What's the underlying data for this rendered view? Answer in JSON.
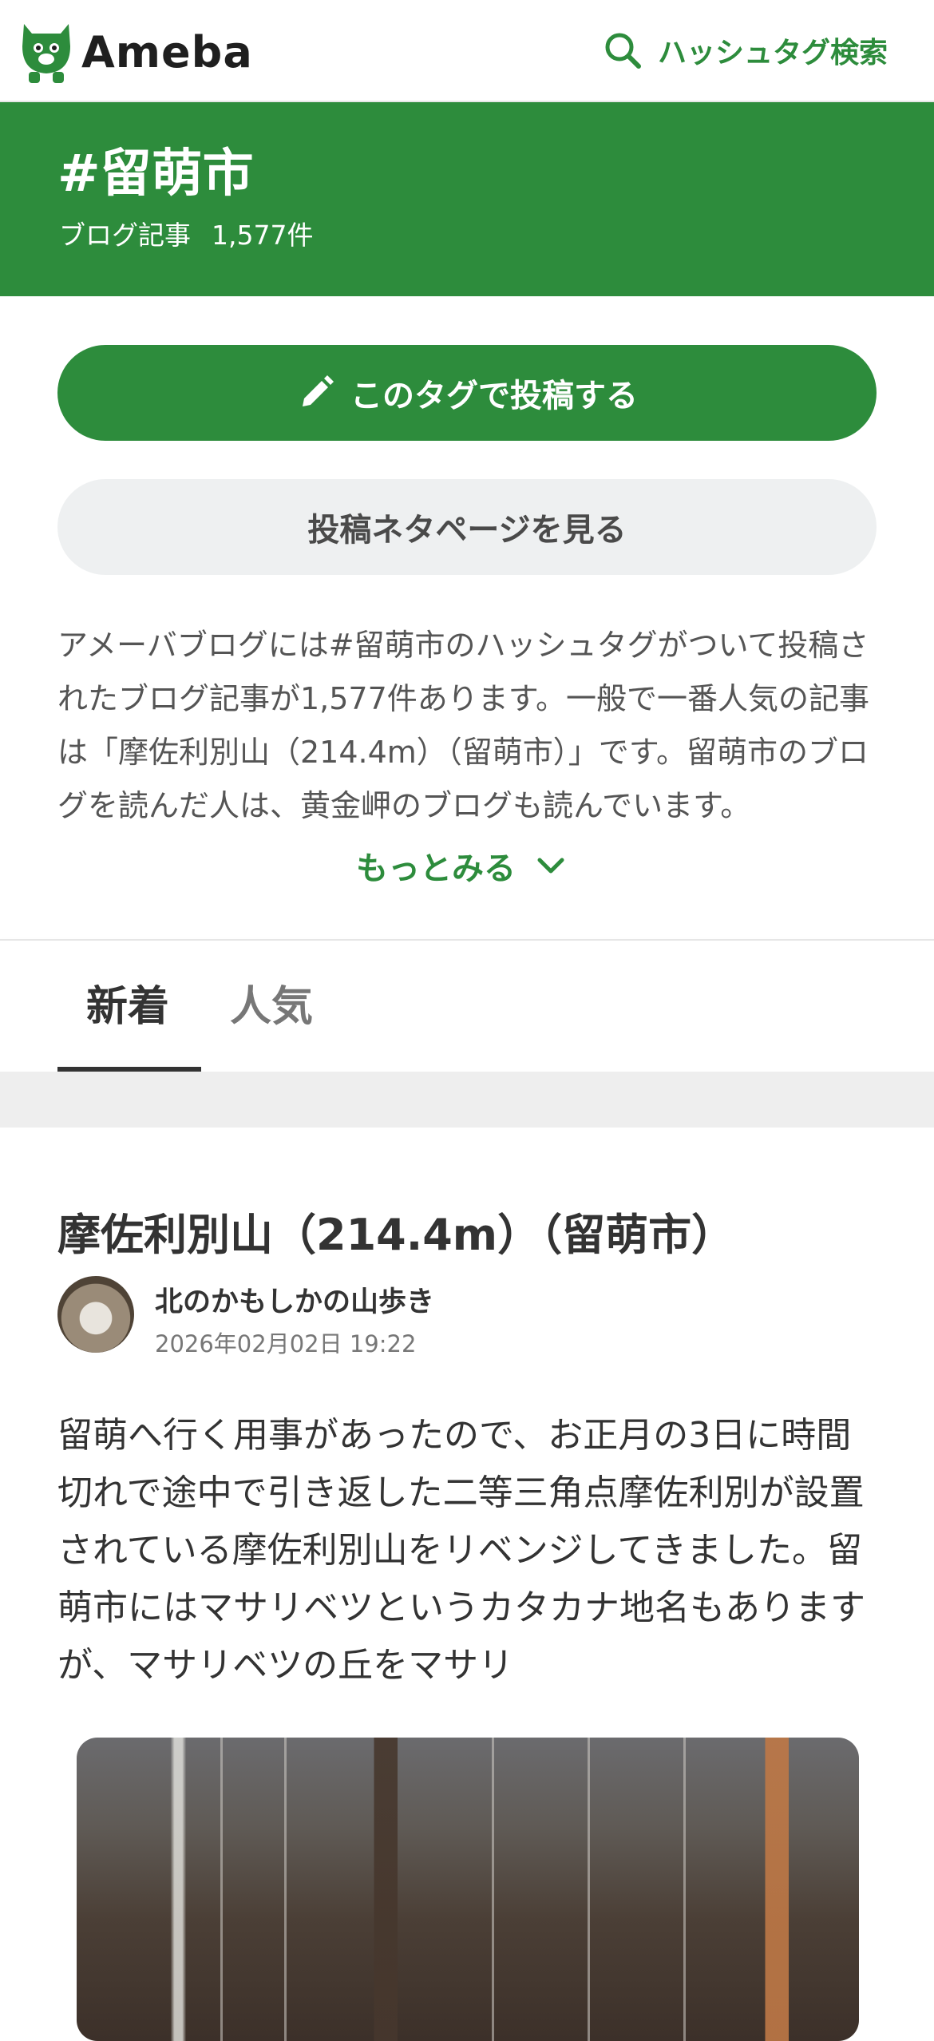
{
  "header": {
    "logo_text": "Ameba",
    "search_label": "ハッシュタグ検索"
  },
  "banner": {
    "tag_title": "#留萌市",
    "count_label": "ブログ記事",
    "count_value": "1,577件"
  },
  "actions": {
    "post_label": "このタグで投稿する",
    "neta_label": "投稿ネタページを見る"
  },
  "description": {
    "text": "アメーバブログには#留萌市のハッシュタグがついて投稿されたブログ記事が1,577件あります。一般で一番人気の記事は「摩佐利別山（214.4m）（留萌市）」です。留萌市のブログを読んだ人は、黄金岬のブログも読んでいます。",
    "more_label": "もっとみる"
  },
  "tabs": [
    {
      "label": "新着",
      "active": true
    },
    {
      "label": "人気",
      "active": false
    }
  ],
  "entry": {
    "title": "摩佐利別山（214.4m）（留萌市）",
    "blogger": "北のかもしかの山歩き",
    "date": "2026年02月02日 19:22",
    "excerpt": "留萌へ行く用事があったので、お正月の3日に時間切れで途中で引き返した二等三角点摩佐利別が設置されている摩佐利別山をリベンジしてきました。留萌市にはマサリベツというカタカナ地名もありますが、マサリベツの丘をマサリ"
  },
  "colors": {
    "brand_green": "#2d8c3c",
    "neutral_button": "#eef0f1",
    "gap_gray": "#eeeeee"
  },
  "icons": [
    "ameba-logo-icon",
    "search-icon",
    "pencil-icon",
    "chevron-down-icon"
  ]
}
